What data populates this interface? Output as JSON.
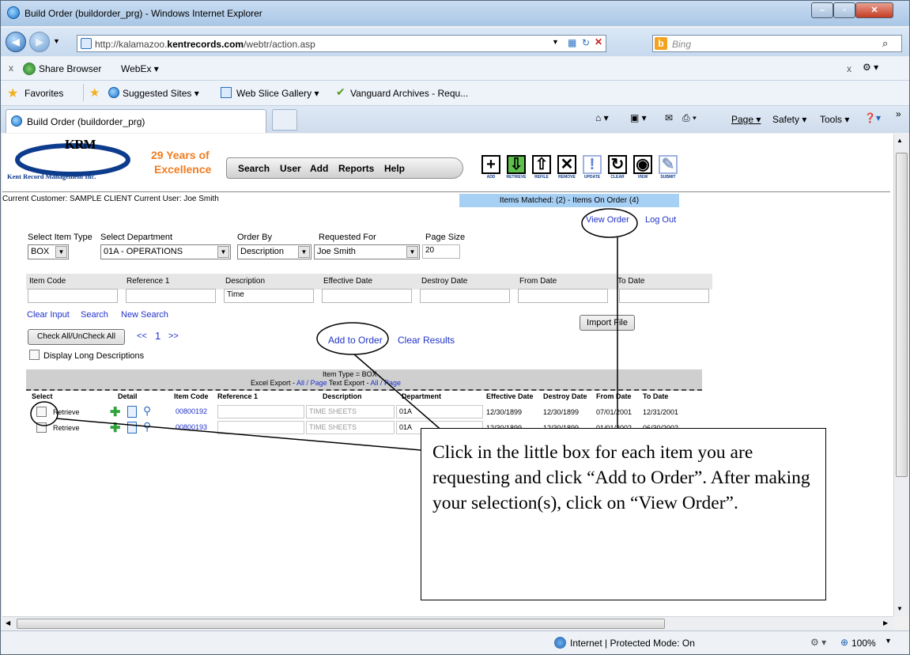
{
  "browser": {
    "title": "Build Order (buildorder_prg) - Windows Internet Explorer",
    "url_prefix": "http://kalamazoo.",
    "url_domain": "kentrecords.com",
    "url_path": "/webtr/action.asp",
    "search_placeholder": "Bing",
    "toolbar2": {
      "close": "x",
      "share": "Share Browser",
      "webex": "WebEx ▾"
    },
    "favorites": {
      "label": "Favorites",
      "items": [
        "Suggested Sites ▾",
        "Web Slice Gallery ▾",
        "Vanguard Archives - Requ..."
      ]
    },
    "tab_title": "Build Order (buildorder_prg)",
    "commands": [
      "Page ▾",
      "Safety ▾",
      "Tools ▾"
    ],
    "status": {
      "zone": "Internet | Protected Mode: On",
      "zoom": "100%"
    }
  },
  "app": {
    "logo_letters": "KRM",
    "company": "Kent Record Management Inc.",
    "slogan1": "29 Years of",
    "slogan2": "Excellence",
    "menu": [
      "Search",
      "User",
      "Add",
      "Reports",
      "Help"
    ],
    "tools": [
      {
        "glyph": "+",
        "cap": "ADD"
      },
      {
        "glyph": "⇩",
        "cap": "RETRIEVE"
      },
      {
        "glyph": "⇧",
        "cap": "REFILE"
      },
      {
        "glyph": "✕",
        "cap": "REMOVE"
      },
      {
        "glyph": "!",
        "cap": "UPDATE"
      },
      {
        "glyph": "↻",
        "cap": "CLEAR"
      },
      {
        "glyph": "◉",
        "cap": "VIEW"
      },
      {
        "glyph": "✎",
        "cap": "SUBMIT"
      }
    ],
    "current": "Current Customer:  SAMPLE CLIENT   Current User:  Joe Smith",
    "items_matched": "Items Matched: (2) - Items On Order (4)",
    "view_order": "View Order",
    "log_out": "Log Out",
    "filters": {
      "item_type_label": "Select Item Type",
      "item_type": "BOX",
      "dept_label": "Select Department",
      "dept": "01A - OPERATIONS",
      "order_label": "Order By",
      "order": "Description",
      "req_label": "Requested For",
      "req": "Joe Smith",
      "page_label": "Page Size",
      "page": "20"
    },
    "search_fields": {
      "item_code": "Item Code",
      "ref1": "Reference 1",
      "desc": "Description",
      "desc_value": "Time",
      "eff": "Effective Date",
      "destroy": "Destroy Date",
      "from": "From Date",
      "to": "To Date"
    },
    "links": {
      "clear_input": "Clear Input",
      "search": "Search",
      "new_search": "New Search"
    },
    "import_file": "Import File",
    "check_all": "Check All/UnCheck All",
    "pager": {
      "prev": "<<",
      "page": "1",
      "next": ">>"
    },
    "add_to_order": "Add to Order",
    "clear_results": "Clear Results",
    "long_desc": "Display Long Descriptions",
    "results": {
      "item_type_line": "Item Type = BOX",
      "export_excel": "Excel Export - ",
      "all": "All",
      "slash": " / ",
      "page": "Page",
      "export_text": " Text Export - ",
      "headers": [
        "Select",
        "Detail",
        "Item Code",
        "Reference 1",
        "Description",
        "Department",
        "Effective Date",
        "Destroy Date",
        "From Date",
        "To Date"
      ],
      "rows": [
        {
          "action": "Retrieve",
          "code": "00800192",
          "desc": "TIME SHEETS",
          "dept": "01A",
          "eff": "12/30/1899",
          "destroy": "12/30/1899",
          "from": "07/01/2001",
          "to": "12/31/2001"
        },
        {
          "action": "Retrieve",
          "code": "00800193",
          "desc": "TIME SHEETS",
          "dept": "01A",
          "eff": "12/30/1899",
          "destroy": "12/30/1899",
          "from": "01/01/2002",
          "to": "06/30/2002"
        }
      ]
    }
  },
  "callout": "Click in the little box for each item you are requesting and click “Add to Order”.  After making your selection(s), click on “View Order”.",
  "colors": {
    "orange": "#ef7d22",
    "link": "#1f32c8",
    "matched_bar": "#a7d0f5"
  }
}
